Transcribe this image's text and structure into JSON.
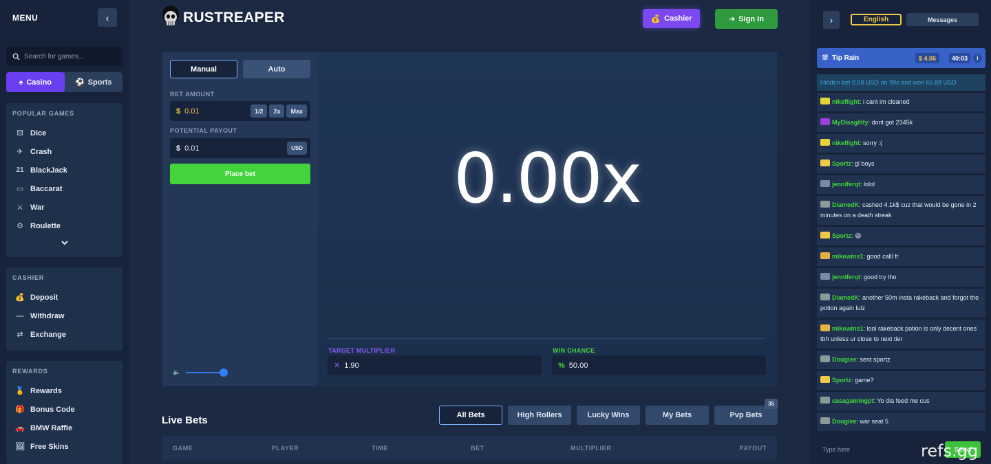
{
  "sidebar": {
    "menu_title": "MENU",
    "search_placeholder": "Search for games...",
    "switch": {
      "casino": "Casino",
      "sports": "Sports"
    },
    "popular": {
      "title": "POPULAR GAMES",
      "items": [
        {
          "label": "Dice",
          "icon": "dice-icon"
        },
        {
          "label": "Crash",
          "icon": "crash-icon"
        },
        {
          "label": "BlackJack",
          "icon": "blackjack-icon"
        },
        {
          "label": "Baccarat",
          "icon": "baccarat-icon"
        },
        {
          "label": "War",
          "icon": "war-icon"
        },
        {
          "label": "Roulette",
          "icon": "roulette-icon"
        }
      ]
    },
    "cashier": {
      "title": "CASHIER",
      "items": [
        {
          "label": "Deposit",
          "icon": "money-bag-icon"
        },
        {
          "label": "Withdraw",
          "icon": "minus-icon"
        },
        {
          "label": "Exchange",
          "icon": "exchange-icon"
        }
      ]
    },
    "rewards": {
      "title": "REWARDS",
      "items": [
        {
          "label": "Rewards",
          "icon": "reward-icon"
        },
        {
          "label": "Bonus Code",
          "icon": "gift-icon"
        },
        {
          "label": "BMW Raffle",
          "icon": "car-icon"
        },
        {
          "label": "Free Skins",
          "icon": "skins-icon"
        }
      ]
    }
  },
  "header": {
    "logo_text": "RUSTREAPER",
    "cashier_label": "Cashier",
    "signin_label": "Sign In"
  },
  "game": {
    "tabs": {
      "manual": "Manual",
      "auto": "Auto"
    },
    "bet_amount_label": "BET AMOUNT",
    "currency_symbol": "$",
    "bet_amount": "0.01",
    "chips": [
      "1/2",
      "2x",
      "Max"
    ],
    "potential_payout_label": "POTENTIAL PAYOUT",
    "potential_payout": "0.01",
    "payout_unit": "USD",
    "place_bet_label": "Place bet",
    "volume": 1.0,
    "multiplier": "0.00x",
    "target_multiplier_label": "TARGET MULTIPLIER",
    "target_multiplier": "1.90",
    "win_chance_label": "WIN CHANCE",
    "win_chance": "50.00"
  },
  "live_bets": {
    "title": "Live Bets",
    "tabs": [
      "All Bets",
      "High Rollers",
      "Lucky Wins",
      "My Bets",
      "Pvp Bets"
    ],
    "pvp_badge": "36",
    "columns": [
      "GAME",
      "PLAYER",
      "TIME",
      "BET",
      "MULTIPLIER",
      "PAYOUT"
    ]
  },
  "chat": {
    "language": "English",
    "messages_label": "Messages",
    "tip_rain": {
      "label": "Tip Rain",
      "amount": "$ 4.06",
      "timer": "40:03",
      "info": "i"
    },
    "hidden_bet": "Hidden bet 0.68 USD on 99x and won 66.88 USD",
    "messages": [
      {
        "user": "nikeflight",
        "text": "i cant im cleaned",
        "color": "#43d43c",
        "avatar": "#e8d23a"
      },
      {
        "user": "MyDisagility",
        "text": "dont got 2345k",
        "color": "#43d43c",
        "avatar": "#9b3fd8"
      },
      {
        "user": "nikeflight",
        "text": "sorry :(",
        "color": "#43d43c",
        "avatar": "#e8d23a"
      },
      {
        "user": "Sportz",
        "text": "gl boys",
        "color": "#43d43c",
        "avatar": "#f2c84a"
      },
      {
        "user": "jenniferqt",
        "text": "lolol",
        "color": "#43d43c",
        "avatar": "#7a8aa4"
      },
      {
        "user": "DiamedK",
        "text": "cashed 4.1k$ cuz that would be gone in 2 minutes on a death streak",
        "color": "#43d43c",
        "avatar": "#8a9a9a"
      },
      {
        "user": "Sportz",
        "text": "😆",
        "color": "#43d43c",
        "avatar": "#f2c84a"
      },
      {
        "user": "mikewins1",
        "text": "good calll fr",
        "color": "#43d43c",
        "avatar": "#e8b040"
      },
      {
        "user": "jenniferqt",
        "text": "good try tho",
        "color": "#43d43c",
        "avatar": "#7a8aa4"
      },
      {
        "user": "DiamedK",
        "text": "another 50m insta rakeback and forgot the potion again lulz",
        "color": "#43d43c",
        "avatar": "#8a9a9a"
      },
      {
        "user": "mikewins1",
        "text": "lool rakeback potion is only decent ones tbh unless ur close to next tier",
        "color": "#43d43c",
        "avatar": "#e8b040"
      },
      {
        "user": "Dougiee",
        "text": "sent sportz",
        "color": "#43d43c",
        "avatar": "#8a9a9a"
      },
      {
        "user": "Sportz",
        "text": "game?",
        "color": "#43d43c",
        "avatar": "#f2c84a"
      },
      {
        "user": "casagamingpt",
        "text": "Yo dia feed me cus",
        "color": "#43d43c",
        "avatar": "#8a9a9a"
      },
      {
        "user": "Dougiee",
        "text": "war seat 5",
        "color": "#43d43c",
        "avatar": "#8a9a9a"
      }
    ],
    "input_placeholder": "Type here",
    "send_label": "Send"
  },
  "watermark": "refs.gg"
}
